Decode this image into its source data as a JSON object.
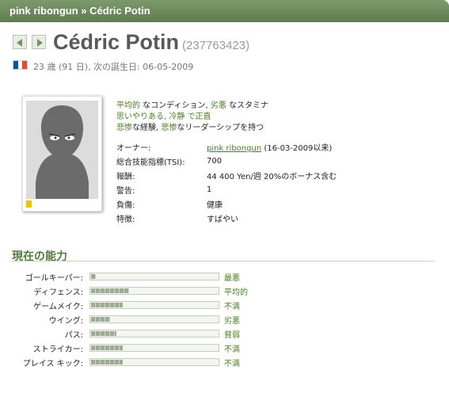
{
  "breadcrumb": {
    "team": "pink ribongun",
    "sep": "»",
    "player": "Cédric Potin"
  },
  "player": {
    "name": "Cédric Potin",
    "id": "(237763423)",
    "flag_colors": [
      "#0055a4",
      "#ffffff",
      "#ef4135"
    ],
    "age_line": "23 歳 (91 日), 次の誕生日: 06-05-2009"
  },
  "details": {
    "line1": {
      "a": "平均的",
      "b": " なコンディション, ",
      "c": "劣悪",
      "d": " なスタミナ"
    },
    "line2": {
      "a": "思いやりある, ",
      "b": "冷静",
      "c": " で正直"
    },
    "line3": {
      "a": "悲惨",
      "b": "な経験, ",
      "c": "悲惨",
      "d": "なリーダーシップを持つ"
    }
  },
  "info": {
    "owner_label": "オーナー:",
    "owner_link": "pink ribongun",
    "owner_since": " (16-03-2009以来)",
    "tsi_label": "総合技能指標(TSI):",
    "tsi_value": "700",
    "salary_label": "報酬:",
    "salary_value": "44 400 Yen/週 20%のボーナス含む",
    "warnings_label": "警告:",
    "warnings_value": "1",
    "injury_label": "負傷:",
    "injury_value": "健康",
    "specialty_label": "特徴:",
    "specialty_value": "すばやい"
  },
  "skills_title": "現在の能力",
  "skills": [
    {
      "label": "ゴールキーパー:",
      "level": "最悪",
      "fill": 0.04
    },
    {
      "label": "ディフェンス:",
      "level": "平均的",
      "fill": 0.3
    },
    {
      "label": "ゲームメイク:",
      "level": "不満",
      "fill": 0.25
    },
    {
      "label": "ウイング:",
      "level": "劣悪",
      "fill": 0.15
    },
    {
      "label": "パス:",
      "level": "貧弱",
      "fill": 0.2
    },
    {
      "label": "ストライカー:",
      "level": "不満",
      "fill": 0.25
    },
    {
      "label": "プレイス キック:",
      "level": "不満",
      "fill": 0.25
    }
  ],
  "card_color": "#f2c300"
}
